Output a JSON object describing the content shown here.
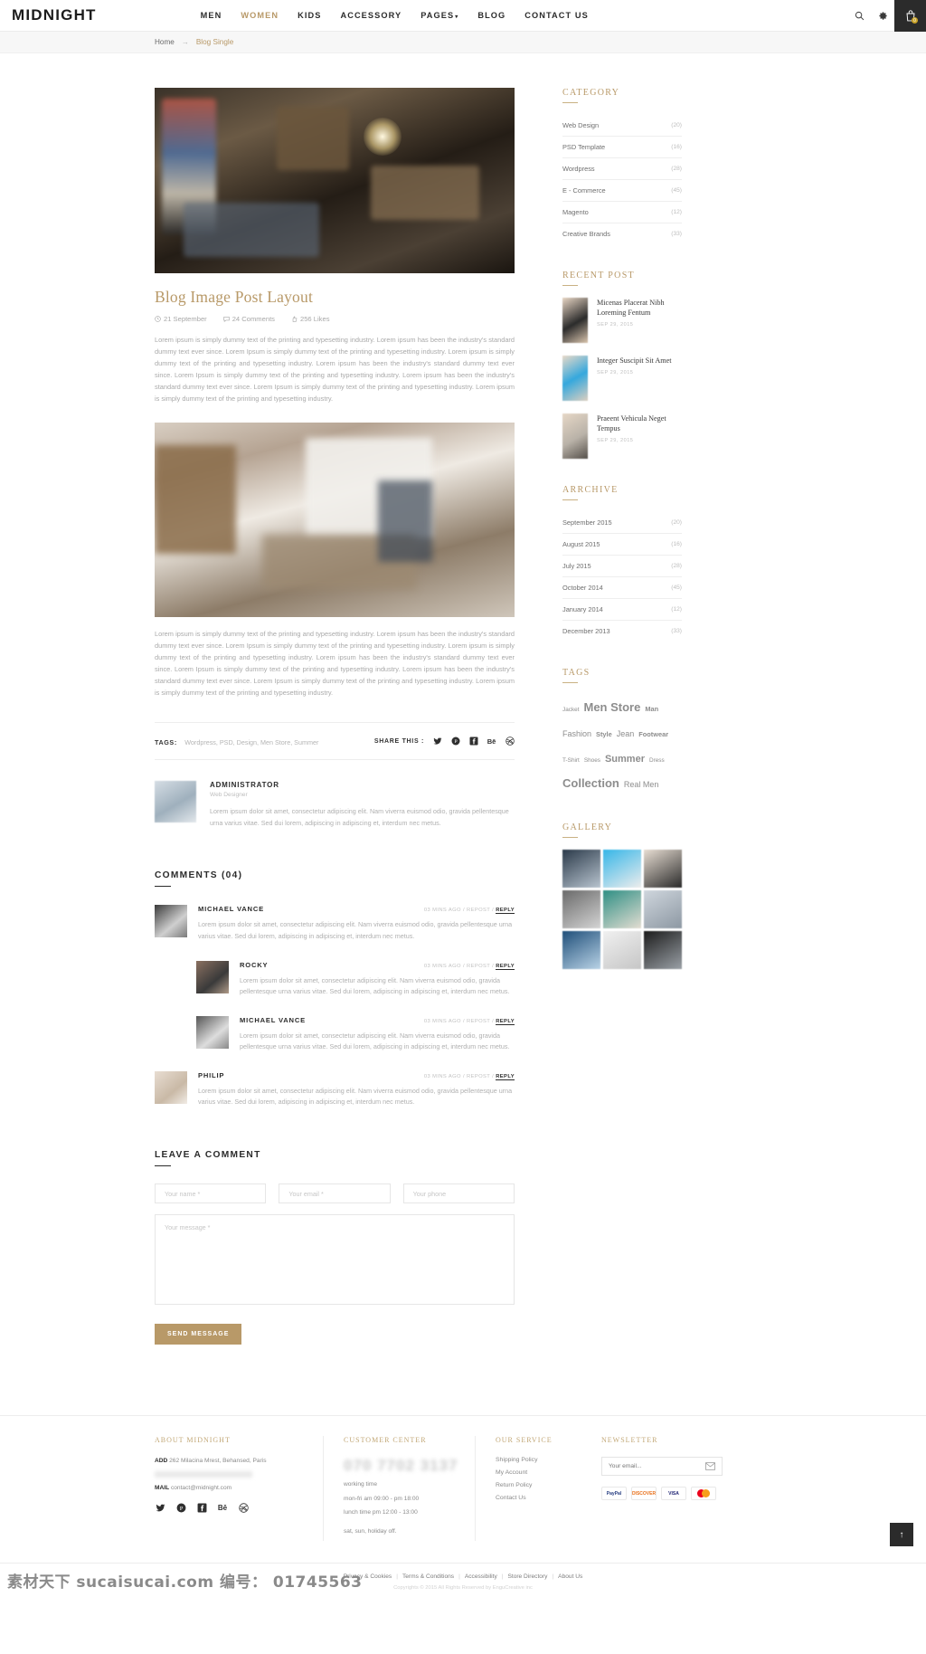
{
  "header": {
    "logo": "MIDNIGHT",
    "nav": [
      {
        "label": "MEN",
        "active": false
      },
      {
        "label": "WOMEN",
        "active": true
      },
      {
        "label": "KIDS",
        "active": false
      },
      {
        "label": "ACCESSORY",
        "active": false
      },
      {
        "label": "PAGES",
        "active": false,
        "caret": true
      },
      {
        "label": "BLOG",
        "active": false
      },
      {
        "label": "CONTACT US",
        "active": false
      }
    ],
    "icons": [
      "search-icon",
      "gear-icon",
      "cart-icon"
    ],
    "cart_count": "0"
  },
  "breadcrumb": {
    "home": "Home",
    "separator": "→",
    "current": "Blog Single"
  },
  "post": {
    "title": "Blog Image Post Layout",
    "meta": {
      "date": "21 September",
      "comments": "24 Comments",
      "likes": "256 Likes"
    },
    "paragraph1": "Lorem ipsum is simply dummy text of the printing and typesetting industry. Lorem ipsum has been the industry's standard dummy text ever since. Lorem Ipsum is simply dummy text of the printing and typesetting industry. Lorem ipsum is simply dummy text of the printing and typesetting industry. Lorem ipsum has been the industry's standard dummy text ever since. Lorem Ipsum is simply dummy text of the printing and typesetting industry. Lorem ipsum has been the industry's standard dummy text ever since. Lorem Ipsum is simply dummy text of the printing and typesetting industry. Lorem ipsum is simply dummy text of the printing and typesetting industry.",
    "paragraph2": "Lorem ipsum is simply dummy text of the printing and typesetting industry. Lorem ipsum has been the industry's standard dummy text ever since. Lorem Ipsum is simply dummy text of the printing and typesetting industry. Lorem ipsum is simply dummy text of the printing and typesetting industry. Lorem ipsum has been the industry's standard dummy text ever since. Lorem Ipsum is simply dummy text of the printing and typesetting industry. Lorem ipsum has been the industry's standard dummy text ever since. Lorem Ipsum is simply dummy text of the printing and typesetting industry. Lorem ipsum is simply dummy text of the printing and typesetting industry."
  },
  "tags_share": {
    "tags_label": "TAGS:",
    "tags_values": "Wordpress, PSD, Design, Men Store, Summer",
    "share_label": "SHARE THIS :",
    "share_icons": [
      "twitter-icon",
      "pinterest-icon",
      "facebook-icon",
      "behance-icon",
      "dribbble-icon"
    ]
  },
  "author": {
    "name": "ADMINISTRATOR",
    "role": "Web Designer",
    "bio": "Lorem ipsum dolor sit amet, consectetur adipiscing elit. Nam viverra euismod odio, gravida pellentesque urna varius vitae. Sed dui lorem, adipiscing in adipiscing et, interdum nec metus."
  },
  "comments": {
    "heading": "COMMENTS (04)",
    "items": [
      {
        "name": "MICHAEL VANCE",
        "level": 1,
        "meta_time": "03 MINS AGO",
        "meta_repost": "REPOST",
        "meta_reply": "REPLY",
        "text": "Lorem ipsum dolor sit amet, consectetur adipiscing elit. Nam viverra euismod odio, gravida pellentesque urna varius vitae. Sed dui lorem, adipiscing in adipiscing et, interdum nec metus."
      },
      {
        "name": "ROCKY",
        "level": 2,
        "meta_time": "03 MINS AGO",
        "meta_repost": "REPOST",
        "meta_reply": "REPLY",
        "text": "Lorem ipsum dolor sit amet, consectetur adipiscing elit. Nam viverra euismod odio, gravida pellentesque urna varius vitae. Sed dui lorem, adipiscing in adipiscing et, interdum nec metus."
      },
      {
        "name": "MICHAEL VANCE",
        "level": 2,
        "meta_time": "03 MINS AGO",
        "meta_repost": "REPOST",
        "meta_reply": "REPLY",
        "text": "Lorem ipsum dolor sit amet, consectetur adipiscing elit. Nam viverra euismod odio, gravida pellentesque urna varius vitae. Sed dui lorem, adipiscing in adipiscing et, interdum nec metus."
      },
      {
        "name": "PHILIP",
        "level": 1,
        "meta_time": "03 MINS AGO",
        "meta_repost": "REPOST",
        "meta_reply": "REPLY",
        "text": "Lorem ipsum dolor sit amet, consectetur adipiscing elit. Nam viverra euismod odio, gravida pellentesque urna varius vitae. Sed dui lorem, adipiscing in adipiscing et, interdum nec metus."
      }
    ]
  },
  "comment_form": {
    "heading": "LEAVE A COMMENT",
    "name_placeholder": "Your name *",
    "email_placeholder": "Your email *",
    "phone_placeholder": "Your phone",
    "message_placeholder": "Your message *",
    "submit_label": "SEND MESSAGE"
  },
  "sidebar": {
    "category": {
      "title": "CATEGORY",
      "items": [
        {
          "label": "Web Design",
          "count": "(20)"
        },
        {
          "label": "PSD Template",
          "count": "(16)"
        },
        {
          "label": "Wordpress",
          "count": "(28)"
        },
        {
          "label": "E - Commerce",
          "count": "(45)"
        },
        {
          "label": "Magento",
          "count": "(12)"
        },
        {
          "label": "Creative Brands",
          "count": "(33)"
        }
      ]
    },
    "recent_post": {
      "title": "RECENT POST",
      "items": [
        {
          "title": "Micenas Placerat Nibh Loreming Fentum",
          "date": "SEP 29, 2015"
        },
        {
          "title": "Integer Suscipit Sit Amet",
          "date": "SEP 29, 2015"
        },
        {
          "title": "Praeent Vehicula Neget Tempus",
          "date": "SEP 29, 2015"
        }
      ]
    },
    "archive": {
      "title": "ARRCHIVE",
      "items": [
        {
          "label": "September 2015",
          "count": "(20)"
        },
        {
          "label": "August 2015",
          "count": "(16)"
        },
        {
          "label": "July 2015",
          "count": "(28)"
        },
        {
          "label": "October 2014",
          "count": "(45)"
        },
        {
          "label": "January 2014",
          "count": "(12)"
        },
        {
          "label": "December 2013",
          "count": "(33)"
        }
      ]
    },
    "tags": {
      "title": "TAGS",
      "items": [
        {
          "label": "Jacket",
          "size": "t-xs"
        },
        {
          "label": "Men Store",
          "size": "t-xl"
        },
        {
          "label": "Man",
          "size": "t-s"
        },
        {
          "label": "Fashion",
          "size": "t-m"
        },
        {
          "label": "Style",
          "size": "t-s"
        },
        {
          "label": "Jean",
          "size": "t-m"
        },
        {
          "label": "Footwear",
          "size": "t-s"
        },
        {
          "label": "T-Shirt",
          "size": "t-xs"
        },
        {
          "label": "Shoes",
          "size": "t-xs"
        },
        {
          "label": "Summer",
          "size": "t-l"
        },
        {
          "label": "Dress",
          "size": "t-xs"
        },
        {
          "label": "Collection",
          "size": "t-xl"
        },
        {
          "label": "Real Men",
          "size": "t-m"
        }
      ]
    },
    "gallery": {
      "title": "GALLERY",
      "cells": 9
    }
  },
  "footer": {
    "about": {
      "title": "ABOUT MIDNIGHT",
      "add_label": "ADD",
      "add_value": "262 Milacina Mrest, Behansed, Paris",
      "mail_label": "MAIL",
      "mail_value": "contact@midnight.com",
      "social": [
        "twitter-icon",
        "pinterest-icon",
        "facebook-icon",
        "behance-icon",
        "dribbble-icon"
      ]
    },
    "customer_center": {
      "title": "CUSTOMER CENTER",
      "phone": "070 7702 3137",
      "working_label": "working time",
      "line1": "mon-fri am 09:00 - pm 18:00",
      "line2": "lunch time pm 12:00 - 13:00",
      "line3": "sat, sun, holiday off."
    },
    "our_service": {
      "title": "OUR SERVICE",
      "links": [
        "Shipping Policy",
        "My Account",
        "Return Policy",
        "Contact Us"
      ]
    },
    "newsletter": {
      "title": "NEWSLETTER",
      "placeholder": "Your email...",
      "payments": [
        "PayPal",
        "DISCOVER",
        "VISA",
        "MasterCard"
      ]
    },
    "bottom_links": [
      "Privacy & Cookies",
      "Terms & Conditions",
      "Accessibility",
      "Store Directory",
      "About Us"
    ],
    "copyright": "Copyrights © 2015 All Rights Reserved by EnguCreative inc"
  },
  "misc": {
    "to_top": "↑",
    "watermark": "素材天下 sucaisucai.com  编号： 01745563"
  }
}
